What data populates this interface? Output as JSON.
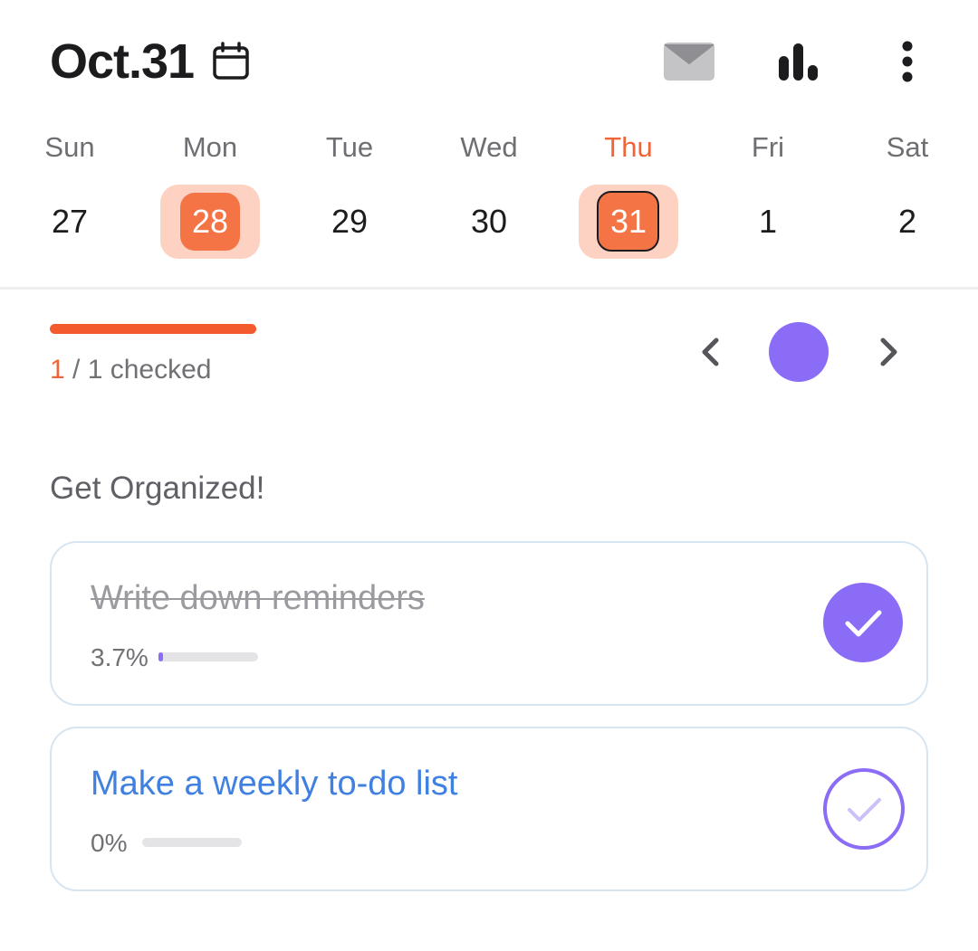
{
  "header": {
    "date_title": "Oct.31",
    "icons": {
      "calendar": "calendar-icon",
      "mail": "mail-icon",
      "stats": "bar-chart-icon",
      "more": "more-vertical-icon"
    }
  },
  "week": {
    "days": [
      {
        "name": "Sun",
        "num": "27",
        "selected": false,
        "today": false
      },
      {
        "name": "Mon",
        "num": "28",
        "selected": true,
        "today": false
      },
      {
        "name": "Tue",
        "num": "29",
        "selected": false,
        "today": false
      },
      {
        "name": "Wed",
        "num": "30",
        "selected": false,
        "today": false
      },
      {
        "name": "Thu",
        "num": "31",
        "selected": true,
        "today": true
      },
      {
        "name": "Fri",
        "num": "1",
        "selected": false,
        "today": false
      },
      {
        "name": "Sat",
        "num": "2",
        "selected": false,
        "today": false
      }
    ]
  },
  "progress": {
    "checked_count": "1",
    "checked_rest": " / 1 checked",
    "fraction": 1.0
  },
  "section": {
    "title": "Get Organized!"
  },
  "tasks": [
    {
      "name": "Write down reminders",
      "percent_label": "3.7%",
      "percent": 3.7,
      "done": true
    },
    {
      "name": "Make a weekly to-do list",
      "percent_label": "0%",
      "percent": 0,
      "done": false
    }
  ],
  "colors": {
    "accent_orange": "#f35b2e",
    "accent_purple": "#8b6cf6",
    "link_blue": "#3f80e0"
  }
}
